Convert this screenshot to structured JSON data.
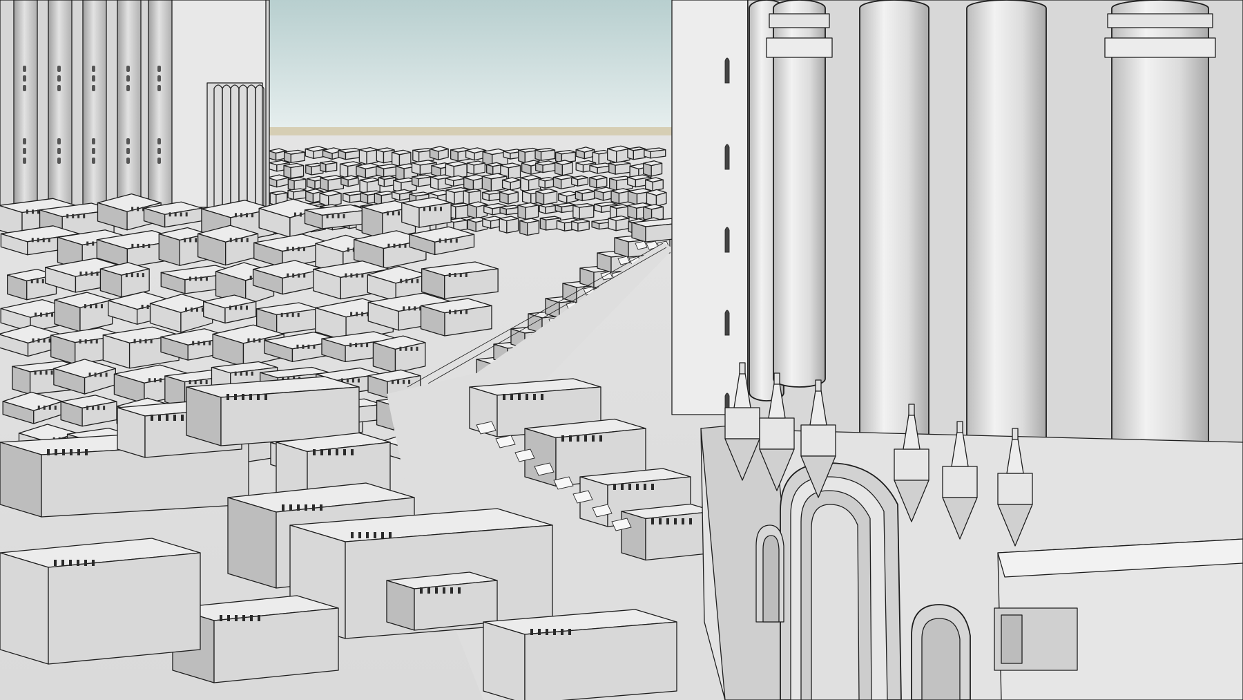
{
  "viewport": {
    "sky_top_color": "#b8cfcf",
    "sky_bottom_color": "#e7efef",
    "horizon_color": "#d6ceb4",
    "face_light": "#ececec",
    "face_mid": "#d8d8d8",
    "face_shade": "#bdbdbd",
    "face_dark": "#a3a3a3",
    "edge_color": "#1e1e1e"
  },
  "scene_objects": [
    "left-tower",
    "right-cathedral",
    "central-street",
    "low-rise-blocks",
    "distant-city",
    "arched-doorway",
    "spire-pinnacles"
  ]
}
